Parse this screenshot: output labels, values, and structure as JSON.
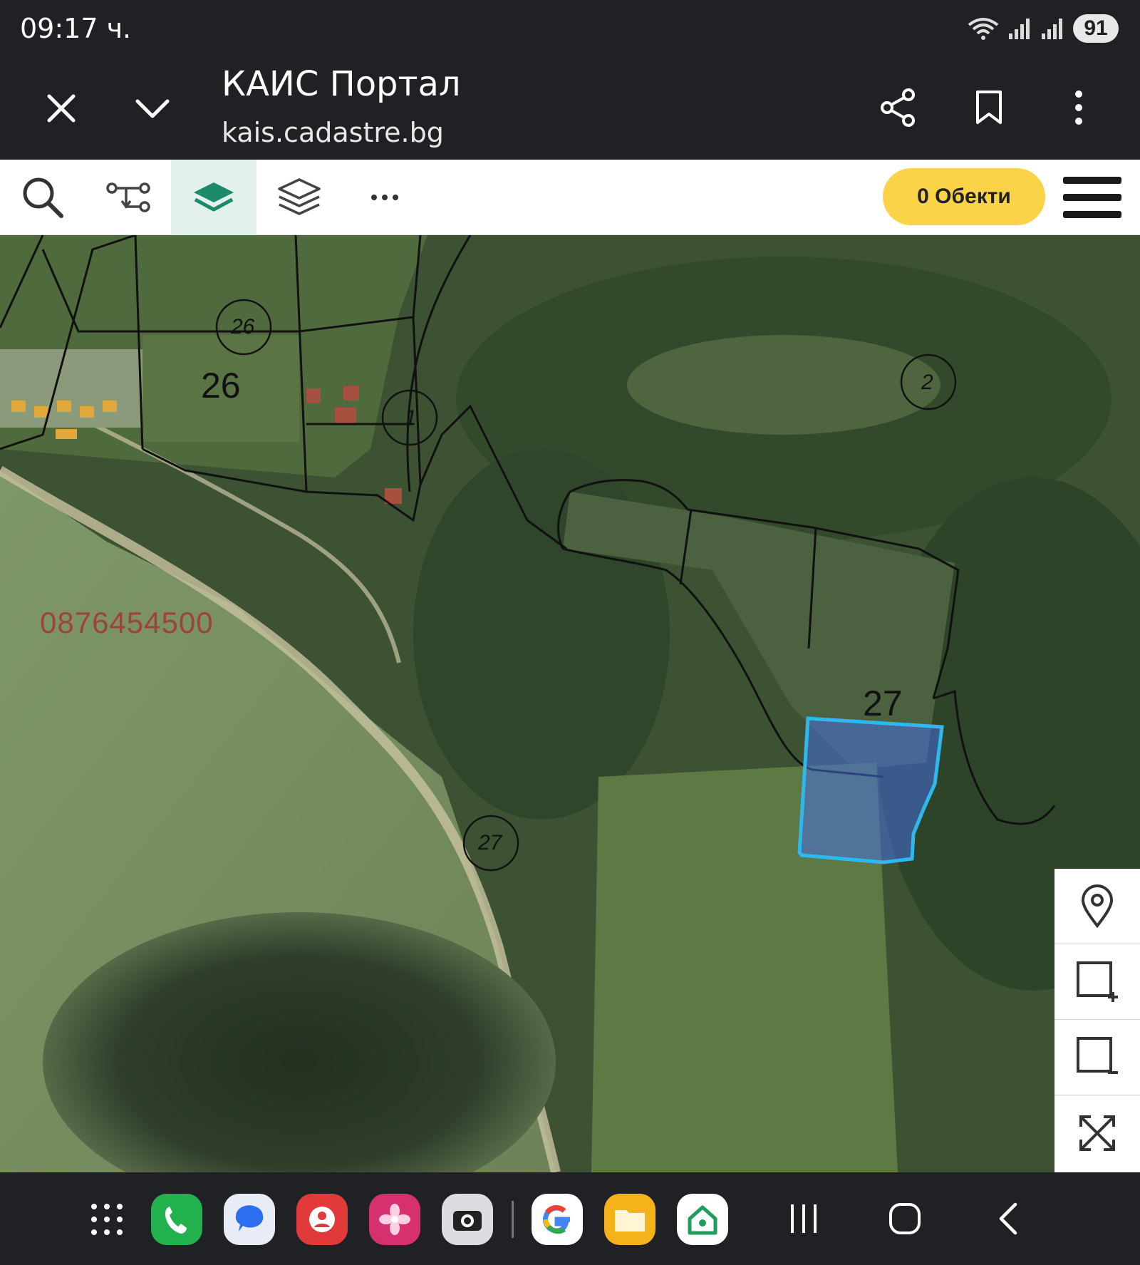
{
  "status_bar": {
    "time": "09:17 ч.",
    "battery": "91",
    "icons": [
      "wifi-icon",
      "signal-icon",
      "signal-icon"
    ]
  },
  "browser": {
    "title": "КАИС Портал",
    "url": "kais.cadastre.bg",
    "icons": [
      "close-icon",
      "chevron-down-icon",
      "share-icon",
      "bookmark-icon",
      "more-vertical-icon"
    ]
  },
  "toolbar": {
    "tools": [
      "search-icon",
      "route-icon",
      "layer-active-icon",
      "layers-icon",
      "more-horizontal-icon"
    ],
    "objects_label": "0 Обекти",
    "menu_icon": "hamburger-menu-icon"
  },
  "map": {
    "region_labels": [
      "26",
      "27"
    ],
    "circle_labels": [
      "26",
      "1",
      "2",
      "27"
    ],
    "watermark": "0876454500",
    "colors": {
      "parcel_border": "#111111",
      "selected_parcel_stroke": "#2fb8ee",
      "selected_parcel_fill": "rgba(70,110,220,0.55)"
    }
  },
  "map_controls": [
    "location-pin-icon",
    "add-area-icon",
    "remove-area-icon",
    "fullscreen-icon"
  ],
  "nav_bar": {
    "apps": [
      "apps-grid-icon",
      "phone-icon",
      "messages-icon",
      "contacts-icon",
      "gallery-icon",
      "camera-icon",
      "google-icon",
      "files-icon",
      "home-app-icon"
    ],
    "system": [
      "recents-icon",
      "home-icon",
      "back-icon"
    ]
  }
}
